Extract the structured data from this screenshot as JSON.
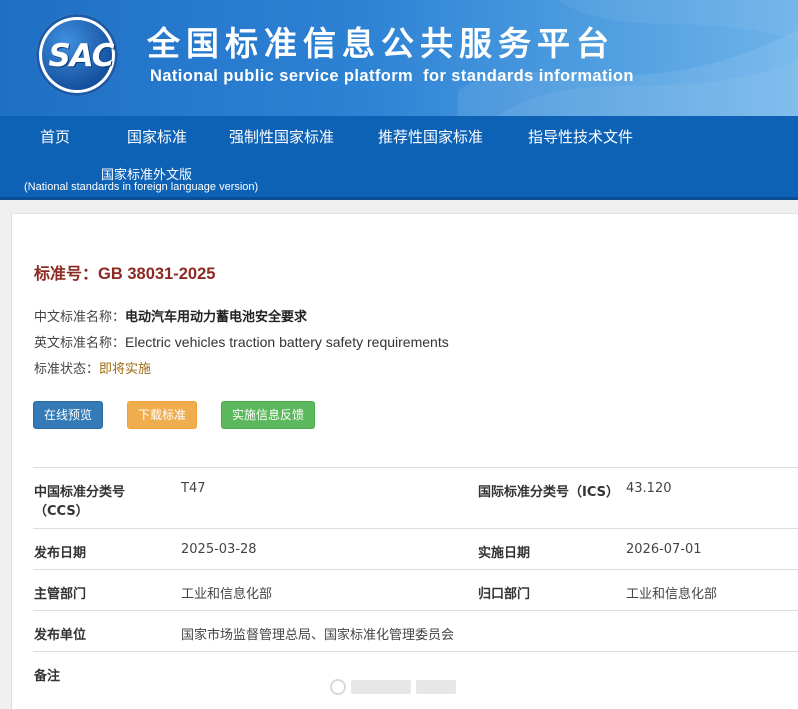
{
  "header": {
    "logo_text": "SAC",
    "title_zh": "全国标准信息公共服务平台",
    "title_en": "National public service platform  for standards information"
  },
  "nav": {
    "items": [
      "首页",
      "国家标准",
      "强制性国家标准",
      "推荐性国家标准",
      "指导性技术文件"
    ],
    "foreign_zh": "国家标准外文版",
    "foreign_en": "(National standards in foreign language version)"
  },
  "standard": {
    "number_label": "标准号：",
    "number": "GB 38031-2025",
    "cn_name_label": "中文标准名称：",
    "cn_name": "电动汽车用动力蓄电池安全要求",
    "en_name_label": "英文标准名称：",
    "en_name": "Electric vehicles traction battery safety requirements",
    "status_label": "标准状态：",
    "status": "即将实施"
  },
  "buttons": {
    "preview": "在线预览",
    "download": "下载标准",
    "feedback": "实施信息反馈"
  },
  "info": {
    "ccs_label_1": "中国标准分类号",
    "ccs_label_2": "（CCS）",
    "ccs_value": "T47",
    "ics_label": "国际标准分类号（ICS）",
    "ics_value": "43.120",
    "publish_date_label": "发布日期",
    "publish_date": "2025-03-28",
    "impl_date_label": "实施日期",
    "impl_date": "2026-07-01",
    "dept_label": "主管部门",
    "dept_value": "工业和信息化部",
    "central_dept_label": "归口部门",
    "central_dept_value": "工业和信息化部",
    "issuer_label": "发布单位",
    "issuer_value": "国家市场监督管理总局、国家标准化管理委员会",
    "remark_label": "备注"
  }
}
